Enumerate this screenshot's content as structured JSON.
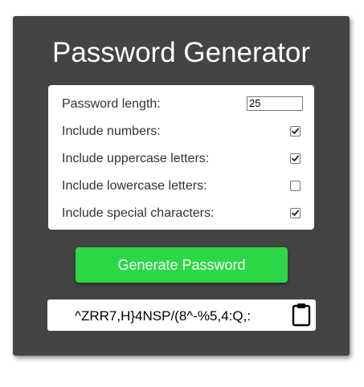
{
  "app": {
    "title": "Password Generator"
  },
  "settings": {
    "length_label": "Password length:",
    "length_value": "25",
    "options": [
      {
        "label": "Include numbers:",
        "checked": true
      },
      {
        "label": "Include uppercase letters:",
        "checked": true
      },
      {
        "label": "Include lowercase letters:",
        "checked": false
      },
      {
        "label": "Include special characters:",
        "checked": true
      }
    ]
  },
  "actions": {
    "generate_label": "Generate Password"
  },
  "result": {
    "password": "^ZRR7,H}4NSP/(8^-%5,4:Q,:",
    "copy_icon": "clipboard-icon"
  },
  "colors": {
    "card_bg": "#444444",
    "button_bg": "#2bd745",
    "text_light": "#ffffff"
  }
}
